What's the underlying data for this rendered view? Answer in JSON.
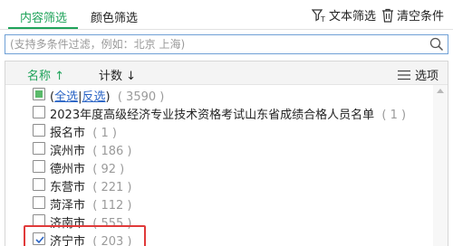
{
  "tabs": {
    "content_filter": "内容筛选",
    "color_filter": "颜色筛选"
  },
  "toolbar": {
    "text_filter": "文本筛选",
    "clear_condition": "清空条件"
  },
  "search": {
    "placeholder": "(支持多条件过滤，例如：北京 上海)",
    "value": ""
  },
  "list_header": {
    "name": "名称",
    "name_sort": "↑",
    "count": "计数",
    "count_sort": "↓",
    "options": "选项"
  },
  "select_all": {
    "open": "(",
    "all": "全选",
    "sep": "|",
    "invert": "反选",
    "close": ")",
    "count": "( 3590 )"
  },
  "items": [
    {
      "label": "2023年度高级经济专业技术资格考试山东省成绩合格人员名单",
      "count": "( 1 )",
      "checked": false
    },
    {
      "label": "报名市",
      "count": "( 1 )",
      "checked": false
    },
    {
      "label": "滨州市",
      "count": "( 186 )",
      "checked": false
    },
    {
      "label": "德州市",
      "count": "( 92 )",
      "checked": false
    },
    {
      "label": "东营市",
      "count": "( 221 )",
      "checked": false
    },
    {
      "label": "菏泽市",
      "count": "( 112 )",
      "checked": false
    },
    {
      "label": "济南市",
      "count": "( 555 )",
      "checked": false
    },
    {
      "label": "济宁市",
      "count": "( 203 )",
      "checked": true
    }
  ],
  "colors": {
    "accent": "#1fa35a",
    "link": "#2a64c5",
    "highlight": "#e03a3a"
  }
}
